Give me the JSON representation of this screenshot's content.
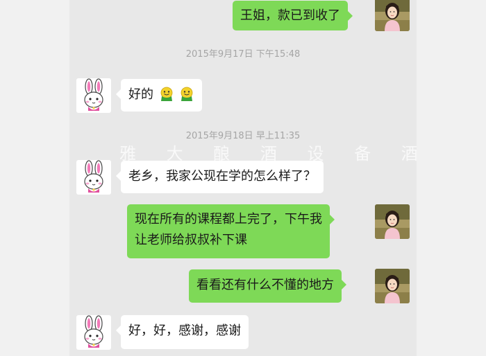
{
  "colors": {
    "chat_background": "#e8e8e8",
    "page_background": "#f1f1f1",
    "sent_bubble": "#7ed957",
    "received_bubble": "#ffffff",
    "timestamp_text": "#a5a5a5"
  },
  "watermark": "雅 大 酿 酒 设 备 酒 曲",
  "timestamps": [
    "2015年9月17日 下午15:48",
    "2015年9月18日 早上11:35"
  ],
  "messages": [
    {
      "direction": "sent",
      "text": "王姐，款已到收了",
      "avatar": "user-photo-avatar"
    },
    {
      "direction": "received",
      "text": "好的",
      "emoji": [
        "green-smiley-emoji",
        "green-smiley-emoji"
      ],
      "avatar": "pink-bunny-avatar"
    },
    {
      "direction": "received",
      "text": "老乡，我家公现在学的怎么样了？",
      "avatar": "pink-bunny-avatar"
    },
    {
      "direction": "sent",
      "lines": [
        "现在所有的课程都上完了，下午我",
        "让老师给叔叔补下课"
      ],
      "avatar": "user-photo-avatar"
    },
    {
      "direction": "sent",
      "text": "看看还有什么不懂的地方",
      "avatar": "user-photo-avatar"
    },
    {
      "direction": "received",
      "text": "好，好，感谢，感谢",
      "avatar": "pink-bunny-avatar"
    }
  ]
}
